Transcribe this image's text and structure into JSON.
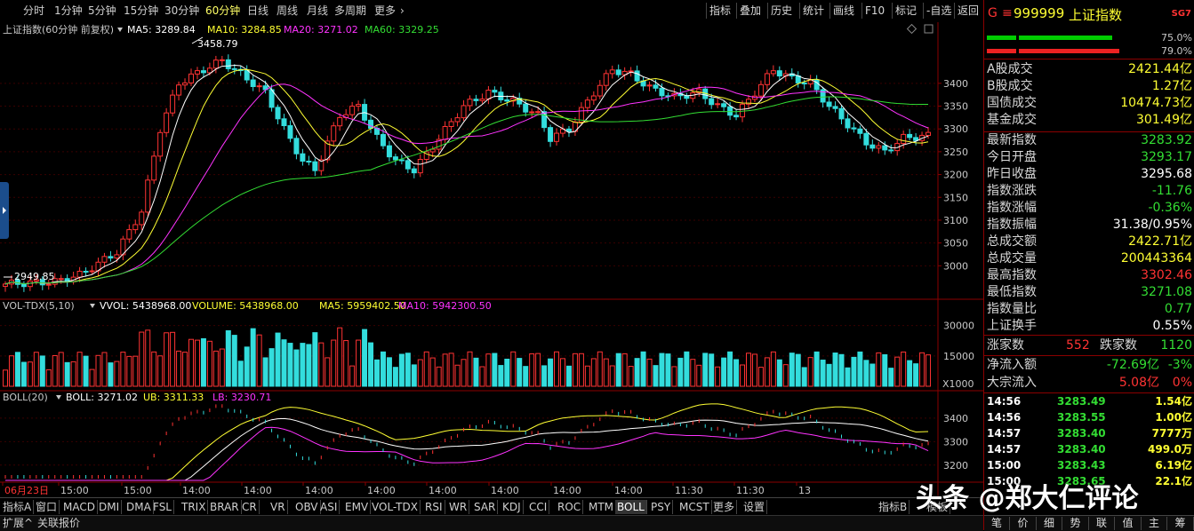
{
  "periods": [
    "分时",
    "1分钟",
    "5分钟",
    "15分钟",
    "30分钟",
    "60分钟",
    "日线",
    "周线",
    "月线",
    "多周期",
    "更多"
  ],
  "active_period": "60分钟",
  "more_chevron": "›",
  "tools": [
    "指标",
    "叠加",
    "历史",
    "统计",
    "画线",
    "F10",
    "标记",
    "-自选",
    "返回"
  ],
  "main": {
    "title": "上证指数(60分钟 前复权)",
    "ma": [
      {
        "label": "MA5: 3289.84",
        "color": "#ffffff"
      },
      {
        "label": "MA10: 3284.85",
        "color": "#ffff33"
      },
      {
        "label": "MA20: 3271.02",
        "color": "#ff33ff"
      },
      {
        "label": "MA60: 3329.25",
        "color": "#33dd33"
      }
    ],
    "high_label": "3458.79",
    "low_label": "2949.85",
    "y_ticks": [
      "3400",
      "3350",
      "3300",
      "3250",
      "3200",
      "3150",
      "3100",
      "3050",
      "3000"
    ]
  },
  "vol": {
    "title": "VOL-TDX(5,10)",
    "items": [
      {
        "label": "VVOL: 5438968.00",
        "color": "#ffffff"
      },
      {
        "label": "VOLUME: 5438968.00",
        "color": "#ffff33"
      },
      {
        "label": "MA5: 5959402.50",
        "color": "#ffff33"
      },
      {
        "label": "MA10: 5942300.50",
        "color": "#ff33ff"
      }
    ],
    "y_ticks": [
      "30000",
      "15000"
    ],
    "unit": "X1000"
  },
  "boll": {
    "title": "BOLL(20)",
    "items": [
      {
        "label": "BOLL: 3271.02",
        "color": "#ffffff"
      },
      {
        "label": "UB: 3311.33",
        "color": "#ffff33"
      },
      {
        "label": "LB: 3230.71",
        "color": "#ff33ff"
      }
    ],
    "y_ticks": [
      "3400",
      "3300",
      "3200"
    ]
  },
  "x_labels": [
    "06月23日",
    "15:00",
    "15:00",
    "14:00",
    "14:00",
    "14:00",
    "14:00",
    "14:00",
    "14:00",
    "14:00",
    "14:00",
    "11:30",
    "11:30",
    "13"
  ],
  "indicator_tabs": [
    "指标A",
    "窗口",
    "MACD",
    "DMI",
    "DMA",
    "FSL",
    "TRIX",
    "BRAR",
    "CR",
    "VR",
    "OBV",
    "ASI",
    "EMV",
    "VOL-TDX",
    "RSI",
    "WR",
    "SAR",
    "KDJ",
    "CCI",
    "ROC",
    "MTM",
    "BOLL",
    "PSY",
    "MCST",
    "更多",
    "设置"
  ],
  "active_indicator": "BOLL",
  "right_tabs": [
    "指标B",
    "模板"
  ],
  "footer": {
    "expand": "扩展^",
    "related": "关联报价"
  },
  "panel": {
    "header_icon": "G",
    "code": "999999",
    "name": "上证指数",
    "badge": "SG7",
    "bar_pcts": [
      "75.0%",
      "79.0%"
    ],
    "flows": [
      {
        "label": "A股成交",
        "value": "2421.44亿",
        "color": "#ffff33"
      },
      {
        "label": "B股成交",
        "value": "1.27亿",
        "color": "#ffff33"
      },
      {
        "label": "国债成交",
        "value": "10474.73亿",
        "color": "#ffff33"
      },
      {
        "label": "基金成交",
        "value": "301.49亿",
        "color": "#ffff33"
      }
    ],
    "quotes": [
      {
        "label": "最新指数",
        "value": "3283.92",
        "color": "#33dd33"
      },
      {
        "label": "今日开盘",
        "value": "3293.17",
        "color": "#33dd33"
      },
      {
        "label": "昨日收盘",
        "value": "3295.68",
        "color": "#ffffff"
      },
      {
        "label": "指数涨跌",
        "value": "-11.76",
        "color": "#33dd33"
      },
      {
        "label": "指数涨幅",
        "value": "-0.36%",
        "color": "#33dd33"
      },
      {
        "label": "指数振幅",
        "value": "31.38/0.95%",
        "color": "#ffffff"
      },
      {
        "label": "总成交额",
        "value": "2422.71亿",
        "color": "#ffff33"
      },
      {
        "label": "总成交量",
        "value": "200443364",
        "color": "#ffff33"
      },
      {
        "label": "最高指数",
        "value": "3302.46",
        "color": "#ff3333"
      },
      {
        "label": "最低指数",
        "value": "3271.08",
        "color": "#33dd33"
      },
      {
        "label": "指数量比",
        "value": "0.77",
        "color": "#33dd33"
      },
      {
        "label": "上证换手",
        "value": "0.55%",
        "color": "#ffffff"
      }
    ],
    "up_label": "涨家数",
    "up_count": "552",
    "down_label": "跌家数",
    "down_count": "1120",
    "netflow": {
      "label": "净流入额",
      "value": "-72.69亿",
      "pct": "-3%"
    },
    "block": {
      "label": "大宗流入",
      "value": "5.08亿",
      "pct": "0%"
    },
    "ticks": [
      {
        "time": "14:56",
        "price": "3283.49",
        "vol": "1.54亿"
      },
      {
        "time": "14:56",
        "price": "3283.55",
        "vol": "1.00亿"
      },
      {
        "time": "14:57",
        "price": "3283.40",
        "vol": "7777万"
      },
      {
        "time": "14:57",
        "price": "3283.40",
        "vol": "499.0万"
      },
      {
        "time": "15:00",
        "price": "3283.43",
        "vol": "6.19亿"
      },
      {
        "time": "15:00",
        "price": "3283.65",
        "vol": "22.1亿"
      }
    ],
    "bottom_tabs": [
      "笔",
      "价",
      "细",
      "势",
      "联",
      "值",
      "主",
      "筹"
    ]
  },
  "watermark": "头条 @郑大仁评论"
}
